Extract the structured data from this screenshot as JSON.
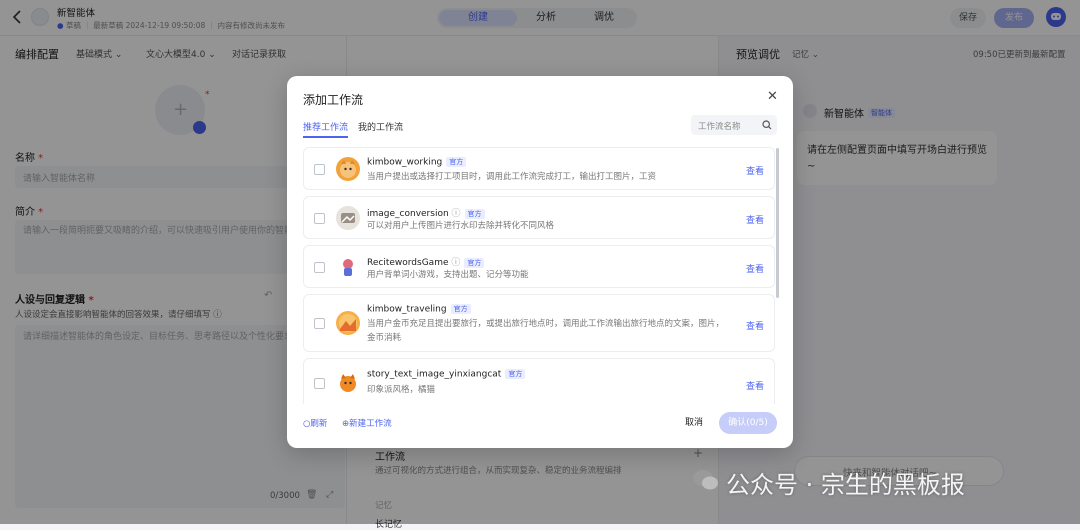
{
  "header": {
    "title": "新智能体",
    "status_draft": "草稿",
    "latest_draft": "最新草稿 2024-12-19 09:50:08",
    "unpublished": "内容有修改尚未发布",
    "tabs": [
      "创建",
      "分析",
      "调优"
    ],
    "save_label": "保存",
    "publish_label": "发布"
  },
  "left": {
    "section_title": "编排配置",
    "mode": "基础模式",
    "model": "文心大模型4.0",
    "dialog_fetch": "对话记录获取",
    "name_label": "名称",
    "name_placeholder": "请输入智能体名称",
    "intro_label": "简介",
    "intro_placeholder": "请输入一段简明扼要又吸睛的介绍，可以快速吸引用户使用你的智能",
    "persona_label": "人设与回复逻辑",
    "persona_hint": "人设设定会直接影响智能体的回答效果，请仔细填写",
    "persona_placeholder": "请详细描述智能体的角色设定、目标任务、思考路径以及个性化要求等",
    "counter": "0/3000"
  },
  "middle": {
    "workflow_title": "工作流",
    "workflow_desc": "通过可视化的方式进行组合，从而实现复杂、稳定的业务流程编排",
    "memory_label": "记忆",
    "memory_sub": "长记忆"
  },
  "right": {
    "title": "预览调优",
    "memory": "记忆",
    "updated": "09:50已更新到最新配置",
    "agent_name": "新智能体",
    "agent_badge": "智能体",
    "welcome": "请在左侧配置页面中填写开场白进行预览~",
    "input_placeholder": "快来和智能体对话吧~"
  },
  "modal": {
    "title": "添加工作流",
    "tabs": [
      "推荐工作流",
      "我的工作流"
    ],
    "search_placeholder": "工作流名称",
    "official_tag": "官方",
    "view_label": "查看",
    "items": [
      {
        "name": "kimbow_working",
        "desc": "当用户提出或选择打工项目时，调用此工作流完成打工，输出打工图片，工资"
      },
      {
        "name": "image_conversion",
        "desc": "可以对用户上传图片进行水印去除并转化不同风格"
      },
      {
        "name": "RecitewordsGame",
        "desc": "用户背单词小游戏，支持出题、记分等功能"
      },
      {
        "name": "kimbow_traveling",
        "desc": "当用户金币充足且提出要旅行，或提出旅行地点时，调用此工作流输出旅行地点的文案，图片，金币消耗"
      },
      {
        "name": "story_text_image_yinxiangcat",
        "desc": "印象派风格，橘猫"
      }
    ],
    "refresh_label": "刷新",
    "new_workflow_label": "新建工作流",
    "cancel_label": "取消",
    "confirm_label": "确认(0/5)"
  },
  "watermark": "公众号 · 宗生的黑板报",
  "colors": {
    "accent": "#4d63ef",
    "tag_bg": "#e9edff",
    "required": "#e5383b"
  }
}
